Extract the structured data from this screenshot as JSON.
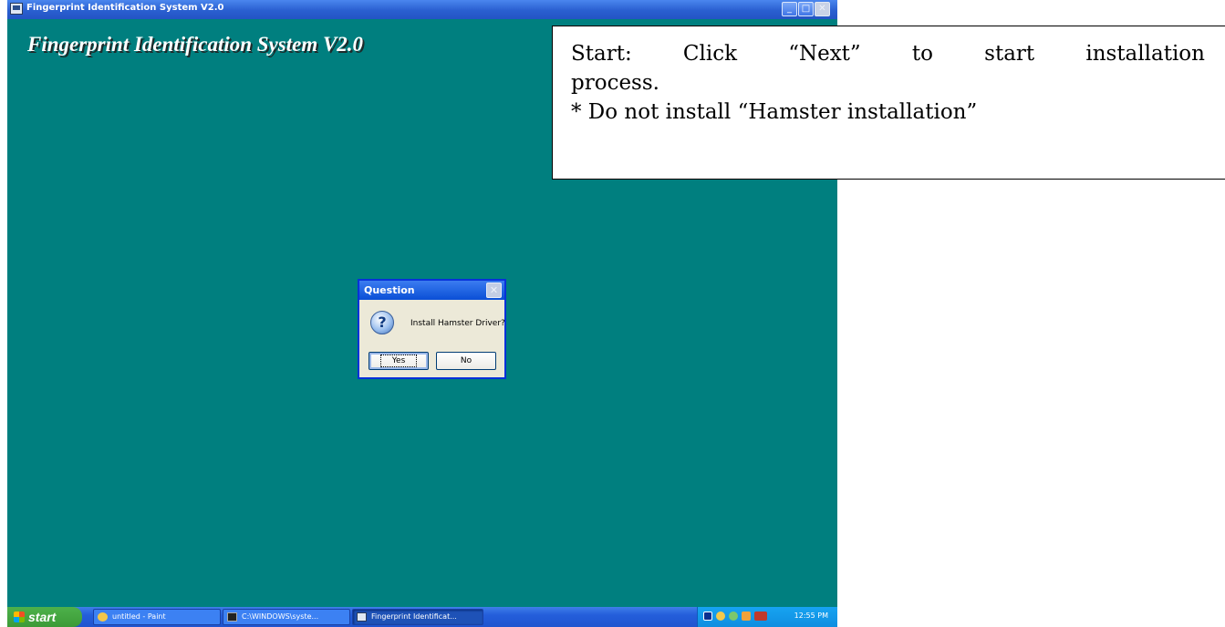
{
  "window": {
    "title": "Fingerprint Identification System V2.0",
    "banner": "Fingerprint Identification System V2.0",
    "minimize_label": "_",
    "maximize_label": "□",
    "close_label": "✕"
  },
  "callout": {
    "line1_words": [
      "Start:",
      "Click",
      "“Next”",
      "to",
      "start",
      "installation"
    ],
    "line2": "process.",
    "line3": "* Do not install “Hamster installation”"
  },
  "dialog": {
    "title": "Question",
    "close_label": "✕",
    "icon": "question-icon",
    "icon_glyph": "?",
    "message": "Install Hamster Driver?",
    "yes_label": "Yes",
    "no_label": "No"
  },
  "taskbar": {
    "start_label": "start",
    "items": [
      {
        "label": "untitled - Paint",
        "icon": "paint-icon",
        "active": false
      },
      {
        "label": "C:\\WINDOWS\\syste...",
        "icon": "cmd-icon",
        "active": false
      },
      {
        "label": "Fingerprint Identificat...",
        "icon": "app-icon",
        "active": true
      }
    ],
    "tray_icons": [
      "media-icon",
      "network-icon",
      "tool-icon",
      "shield-icon",
      "ati-icon"
    ],
    "clock": "12:55 PM"
  },
  "colors": {
    "desktop": "#007f7f",
    "titlebar": "#2a5fd0",
    "dialog_bg": "#ece9d8",
    "taskbar": "#245edb",
    "start_green": "#3c9a37"
  }
}
